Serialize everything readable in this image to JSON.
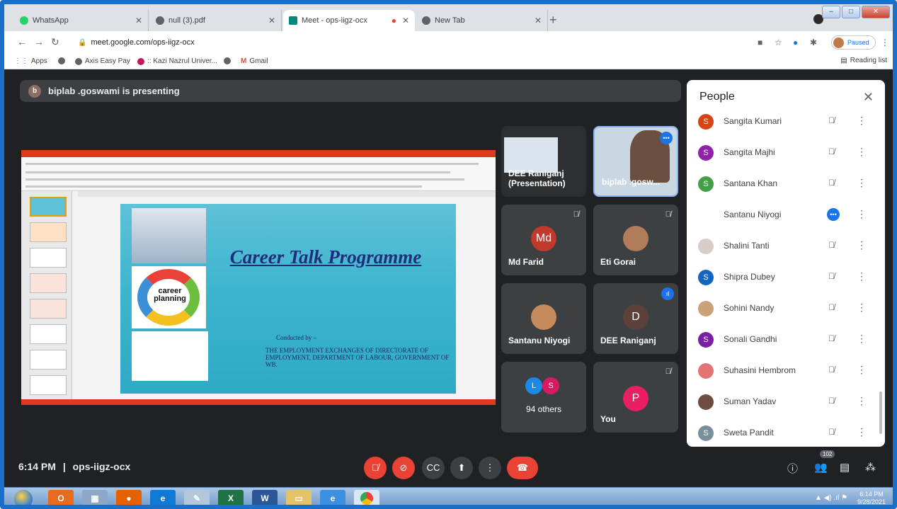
{
  "browser": {
    "tabs": [
      {
        "label": "WhatsApp",
        "icon": "whatsapp-icon",
        "color": "#25d366"
      },
      {
        "label": "null (3).pdf",
        "icon": "globe-icon",
        "color": "#5f6368"
      },
      {
        "label": "Meet - ops-iigz-ocx",
        "icon": "meet-icon",
        "color": "#00897b"
      },
      {
        "label": "New Tab",
        "icon": "chrome-icon",
        "color": "#5f6368"
      }
    ],
    "url": "meet.google.com/ops-iigz-ocx",
    "profile_status": "Paused",
    "bookmarks": [
      {
        "label": "Apps",
        "icon": "apps-grid-icon"
      },
      {
        "label": "",
        "icon": "globe-icon"
      },
      {
        "label": "Axis Easy Pay",
        "icon": "globe-icon"
      },
      {
        "label": ":: Kazi Nazrul Univer...",
        "icon": "university-icon"
      },
      {
        "label": "",
        "icon": "globe-icon"
      },
      {
        "label": "Gmail",
        "icon": "gmail-icon"
      }
    ],
    "reading_list": "Reading list"
  },
  "meet": {
    "presenting_banner": "biplab .goswami is presenting",
    "presenter_initial": "b",
    "slide": {
      "title": "Career Talk Programme",
      "cycle_label": "career planning",
      "conducted_by": "Conducted by –",
      "org": "THE EMPLOYMENT EXCHANGES OF DIRECTORATE OF EMPLOYMENT, DEPARTMENT OF LABOUR, GOVERNMENT OF WB."
    },
    "tiles": [
      {
        "name": "DEE Raniganj (Presentation)",
        "initial": ""
      },
      {
        "name": "biplab .gosw...",
        "initial": ""
      },
      {
        "name": "Md Farid",
        "initial": "Md",
        "color": "#c0392b"
      },
      {
        "name": "Eti Gorai",
        "initial": ""
      },
      {
        "name": "Santanu Niyogi",
        "initial": ""
      },
      {
        "name": "DEE Raniganj",
        "initial": "D",
        "color": "#5d4037"
      },
      {
        "name": "94 others",
        "initial": ""
      },
      {
        "name": "You",
        "initial": "P",
        "color": "#e91e63"
      }
    ],
    "others_initials": [
      "L",
      "S"
    ],
    "people_panel": {
      "title": "People",
      "list": [
        {
          "name": "Sangita Kumari",
          "initial": "S",
          "color": "#d84315",
          "status": "muted"
        },
        {
          "name": "Sangita Majhi",
          "initial": "S",
          "color": "#8e24aa",
          "status": "muted"
        },
        {
          "name": "Santana Khan",
          "initial": "S",
          "color": "#43a047",
          "status": "muted"
        },
        {
          "name": "Santanu Niyogi",
          "initial": "",
          "color": "#ffffff",
          "status": "speaking"
        },
        {
          "name": "Shalini Tanti",
          "initial": "",
          "color": "#d7ccc8",
          "status": "muted"
        },
        {
          "name": "Shipra Dubey",
          "initial": "S",
          "color": "#1565c0",
          "status": "muted"
        },
        {
          "name": "Sohini Nandy",
          "initial": "",
          "color": "#c9a27a",
          "status": "muted"
        },
        {
          "name": "Sonali Gandhi",
          "initial": "S",
          "color": "#7b1fa2",
          "status": "muted"
        },
        {
          "name": "Suhasini Hembrom",
          "initial": "",
          "color": "#e57373",
          "status": "muted"
        },
        {
          "name": "Suman Yadav",
          "initial": "",
          "color": "#6d4c41",
          "status": "muted"
        },
        {
          "name": "Sweta Pandit",
          "initial": "S",
          "color": "#78909c",
          "status": "muted"
        }
      ]
    },
    "footer": {
      "time": "6:14 PM",
      "separator": "|",
      "meeting_code": "ops-iigz-ocx",
      "participant_count": "102"
    }
  },
  "taskbar": {
    "time": "6:14 PM",
    "date": "9/28/2021"
  }
}
